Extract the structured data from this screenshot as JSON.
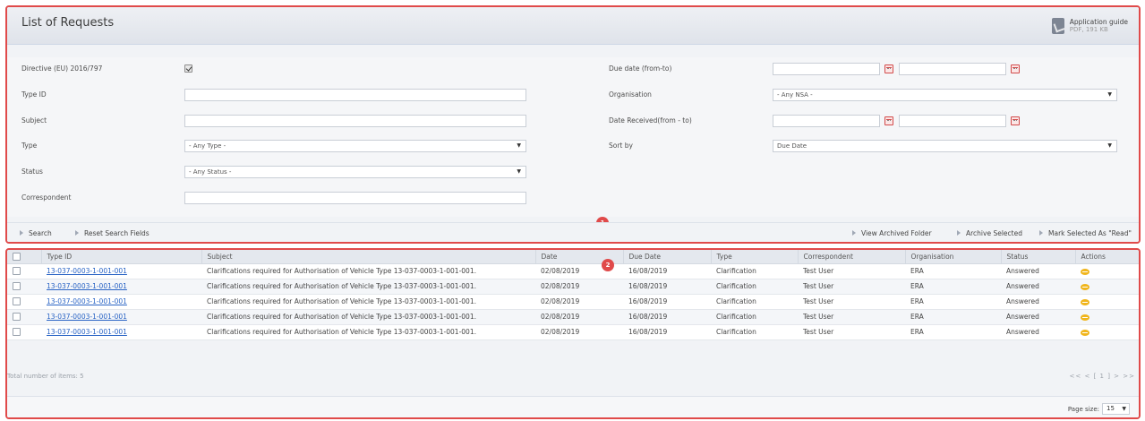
{
  "header": {
    "title": "List of Requests",
    "guide_title": "Application guide",
    "guide_meta": "PDF, 191 KB",
    "guide_icon": "pdf-icon"
  },
  "form": {
    "directive_label": "Directive (EU) 2016/797",
    "directive_checked": true,
    "type_id_label": "Type ID",
    "type_id_value": "",
    "subject_label": "Subject",
    "subject_value": "",
    "type_label": "Type",
    "type_value": "- Any Type -",
    "status_label": "Status",
    "status_value": "- Any Status -",
    "correspondent_label": "Correspondent",
    "correspondent_value": "",
    "due_date_label": "Due date (from-to)",
    "organisation_label": "Organisation",
    "organisation_value": "- Any NSA -",
    "date_received_label": "Date Received(from - to)",
    "sort_by_label": "Sort by",
    "sort_by_value": "Due Date"
  },
  "actions": {
    "search": "Search",
    "reset": "Reset Search Fields",
    "view_archived": "View Archived Folder",
    "archive_selected": "Archive Selected",
    "mark_read": "Mark Selected As \"Read\""
  },
  "badges": {
    "one": "1",
    "two": "2"
  },
  "table": {
    "headers": [
      "Type ID",
      "Subject",
      "Date",
      "Due Date",
      "Type",
      "Correspondent",
      "Organisation",
      "Status",
      "Actions"
    ],
    "rows": [
      {
        "type_id": "13-037-0003-1-001-001",
        "subject": "Clarifications required for Authorisation of Vehicle Type 13-037-0003-1-001-001.",
        "date": "02/08/2019",
        "due": "16/08/2019",
        "type": "Clarification",
        "correspondent": "Test User",
        "organisation": "ERA",
        "status": "Answered"
      },
      {
        "type_id": "13-037-0003-1-001-001",
        "subject": "Clarifications required for Authorisation of Vehicle Type 13-037-0003-1-001-001.",
        "date": "02/08/2019",
        "due": "16/08/2019",
        "type": "Clarification",
        "correspondent": "Test User",
        "organisation": "ERA",
        "status": "Answered"
      },
      {
        "type_id": "13-037-0003-1-001-001",
        "subject": "Clarifications required for Authorisation of Vehicle Type 13-037-0003-1-001-001.",
        "date": "02/08/2019",
        "due": "16/08/2019",
        "type": "Clarification",
        "correspondent": "Test User",
        "organisation": "ERA",
        "status": "Answered"
      },
      {
        "type_id": "13-037-0003-1-001-001",
        "subject": "Clarifications required for Authorisation of Vehicle Type 13-037-0003-1-001-001.",
        "date": "02/08/2019",
        "due": "16/08/2019",
        "type": "Clarification",
        "correspondent": "Test User",
        "organisation": "ERA",
        "status": "Answered"
      },
      {
        "type_id": "13-037-0003-1-001-001",
        "subject": "Clarifications required for Authorisation of Vehicle Type 13-037-0003-1-001-001.",
        "date": "02/08/2019",
        "due": "16/08/2019",
        "type": "Clarification",
        "correspondent": "Test User",
        "organisation": "ERA",
        "status": "Answered"
      }
    ],
    "action_icon": "message-icon"
  },
  "footer": {
    "total": "Total number of items: 5",
    "pager": "<< < [ 1 ] > >>",
    "page_size_label": "Page size:",
    "page_size_value": "15"
  },
  "colors": {
    "highlight_border": "#e04a4a",
    "link": "#2a64c5",
    "calendar_icon": "#d24b4b",
    "action_icon": "#f0b51c"
  }
}
